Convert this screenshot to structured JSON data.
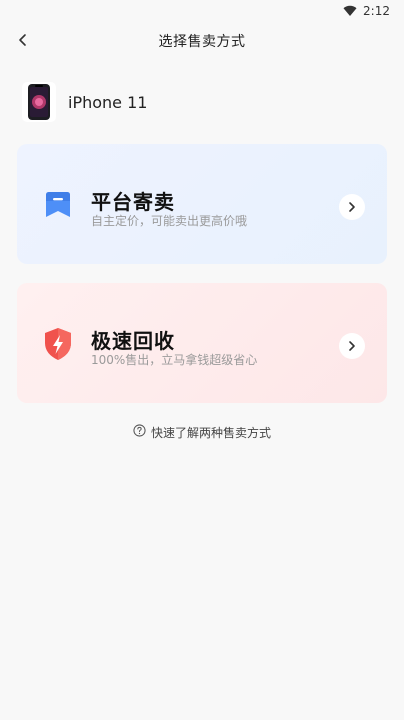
{
  "status_bar": {
    "time": "2:12",
    "wifi_icon": "wifi-icon"
  },
  "nav": {
    "title": "选择售卖方式",
    "back_icon": "chevron-left-icon"
  },
  "product": {
    "name": "iPhone 11",
    "image_icon": "iphone-thumbnail"
  },
  "options": [
    {
      "title": "平台寄卖",
      "subtitle": "自主定价，可能卖出更高价哦",
      "icon": "bookmark-flag-icon",
      "icon_color": "#4e8ff7",
      "background": "#eaf2fd"
    },
    {
      "title": "极速回收",
      "subtitle": "100%售出，立马拿钱超级省心",
      "icon": "lightning-shield-icon",
      "icon_color": "#f0524d",
      "background": "#fde9ea"
    }
  ],
  "help": {
    "label": "快速了解两种售卖方式",
    "icon": "question-circle-icon"
  }
}
